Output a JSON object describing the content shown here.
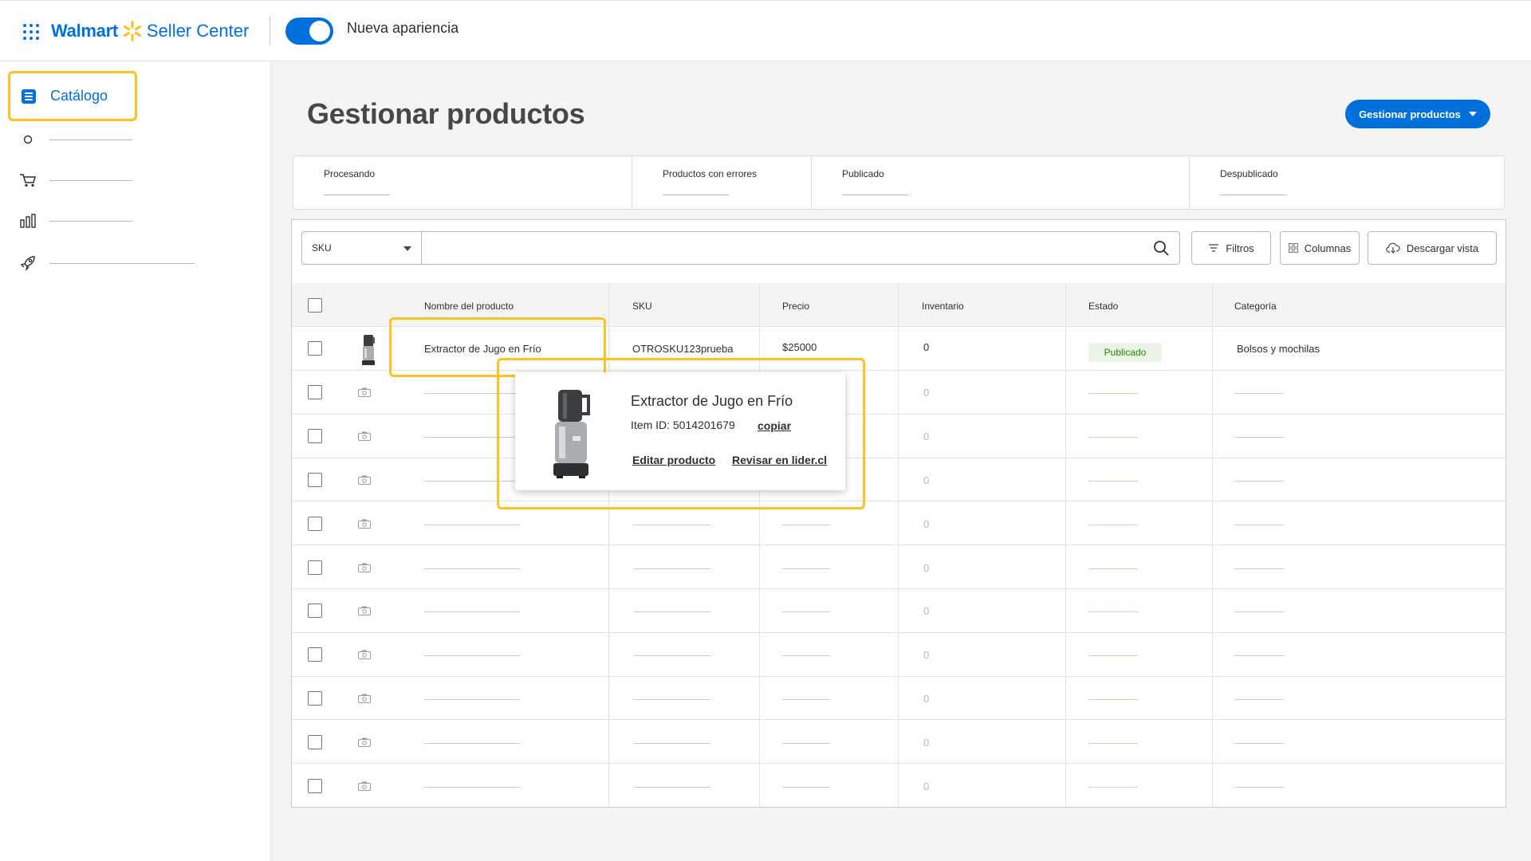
{
  "header": {
    "brand": "Walmart",
    "product": "Seller Center",
    "toggle_label": "Nueva apariencia",
    "toggle_on": true,
    "brand_color": "#0071dc",
    "spark_color": "#ffc220"
  },
  "sidebar": {
    "active_label": "Catálogo",
    "items": [
      {
        "icon": "circle-icon"
      },
      {
        "icon": "cart-icon"
      },
      {
        "icon": "bar-chart-icon"
      },
      {
        "icon": "rocket-icon"
      }
    ]
  },
  "page": {
    "title": "Gestionar productos",
    "primary_button": "Gestionar productos"
  },
  "stats": [
    {
      "label": "Procesando"
    },
    {
      "label": "Productos con errores"
    },
    {
      "label": "Publicado"
    },
    {
      "label": "Despublicado"
    }
  ],
  "toolbar": {
    "search_field": "SKU",
    "search_placeholder": "",
    "filters": "Filtros",
    "columns": "Columnas",
    "download": "Descargar vista"
  },
  "table": {
    "headers": {
      "name": "Nombre del producto",
      "sku": "SKU",
      "price": "Precio",
      "inventory": "Inventario",
      "status": "Estado",
      "category": "Categoría"
    },
    "first_row": {
      "name": "Extractor de Jugo en Frío",
      "sku": "OTROSKU123prueba",
      "price": "$25000",
      "inventory": "0",
      "status": "Publicado",
      "category": "Bolsos y mochilas"
    },
    "placeholder_inventory": "0",
    "placeholder_rows": [
      {
        "status_tone": "green"
      },
      {
        "status_tone": "green"
      },
      {
        "status_tone": "green"
      },
      {
        "status_tone": "red"
      },
      {
        "status_tone": "green"
      },
      {
        "status_tone": "red"
      },
      {
        "status_tone": "green"
      },
      {
        "status_tone": "green"
      },
      {
        "status_tone": "green"
      },
      {
        "status_tone": "red"
      }
    ]
  },
  "popup": {
    "title": "Extractor de Jugo en Frío",
    "item_id": "Item ID: 5014201679",
    "copy": "copiar",
    "edit": "Editar producto",
    "review": "Revisar en lider.cl"
  }
}
